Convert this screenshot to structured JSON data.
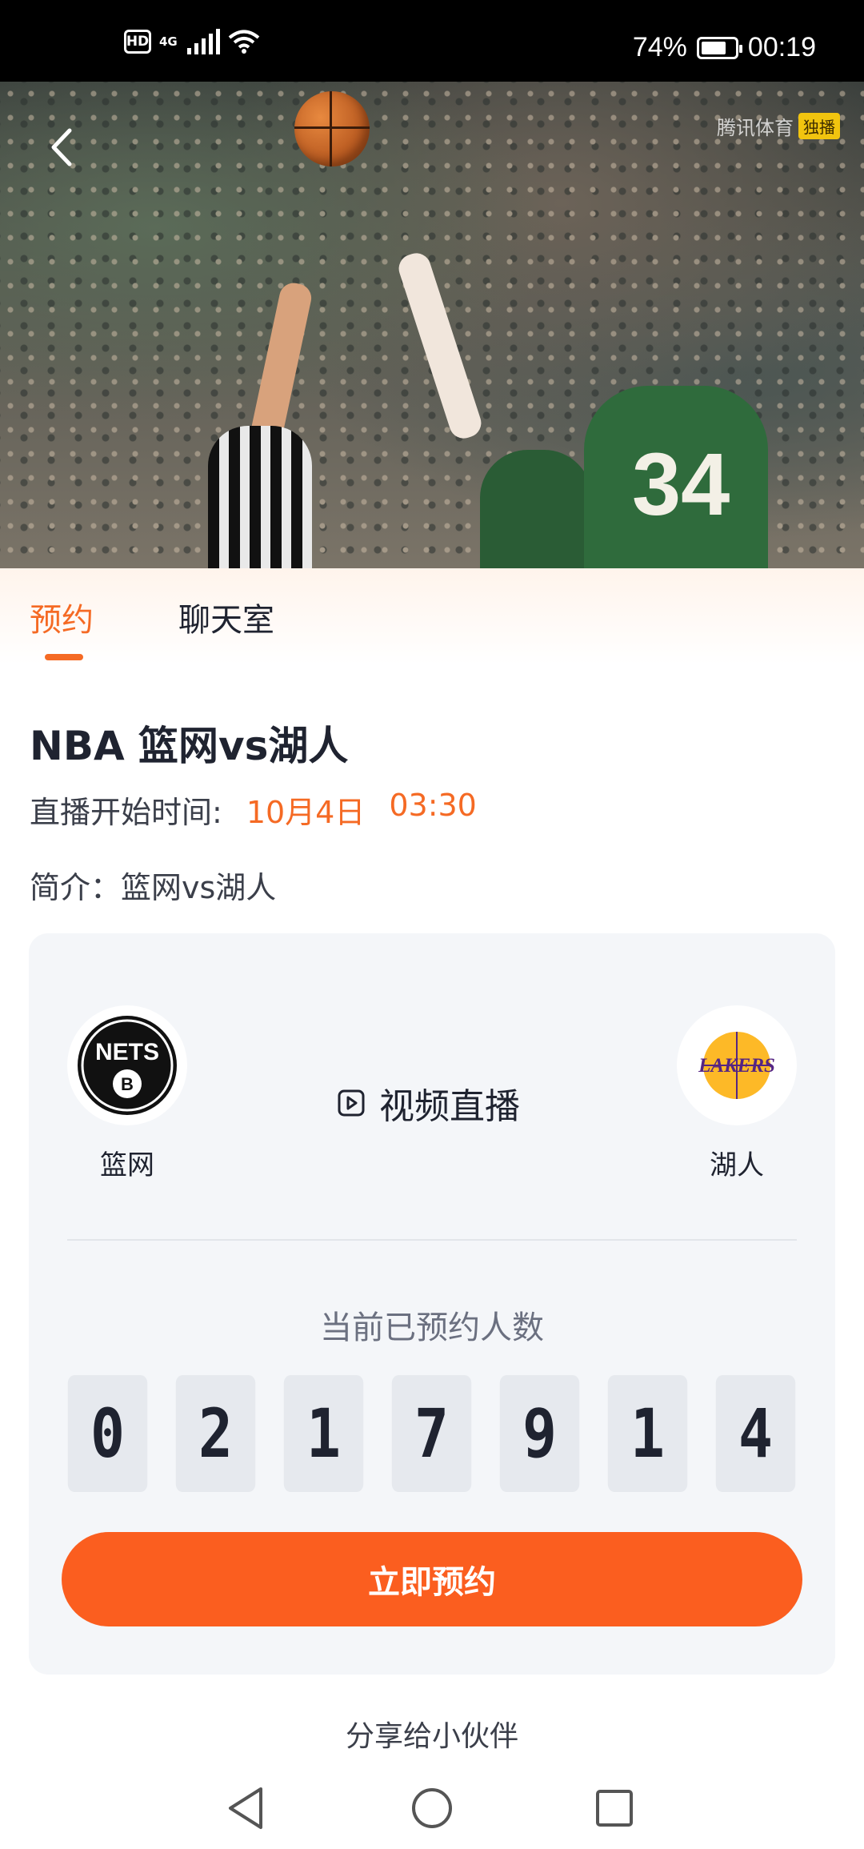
{
  "status_bar": {
    "hd": "HD",
    "network": "4G",
    "battery": "74%",
    "battery_level": 0.74,
    "time": "00:19"
  },
  "hero": {
    "watermark": "腾讯体育",
    "watermark_tag": "独播",
    "jersey_number": "34"
  },
  "tabs": [
    {
      "label": "预约",
      "active": true
    },
    {
      "label": "聊天室",
      "active": false
    }
  ],
  "event": {
    "title": "NBA 篮网vs湖人",
    "time_label": "直播开始时间:",
    "time_date": "10月4日",
    "time_clock": "03:30",
    "intro": "简介：篮网vs湖人"
  },
  "match": {
    "home_team": "篮网",
    "home_logo_text": "NETS",
    "away_team": "湖人",
    "away_logo_text": "LAKERS",
    "video_label": "视频直播",
    "count_label": "当前已预约人数",
    "count_digits": [
      "0",
      "2",
      "1",
      "7",
      "9",
      "1",
      "4"
    ],
    "reserve_button": "立即预约"
  },
  "share": "分享给小伙伴",
  "colors": {
    "accent": "#f56a24",
    "button": "#fb5e1f",
    "card_bg": "#f4f6f9"
  }
}
